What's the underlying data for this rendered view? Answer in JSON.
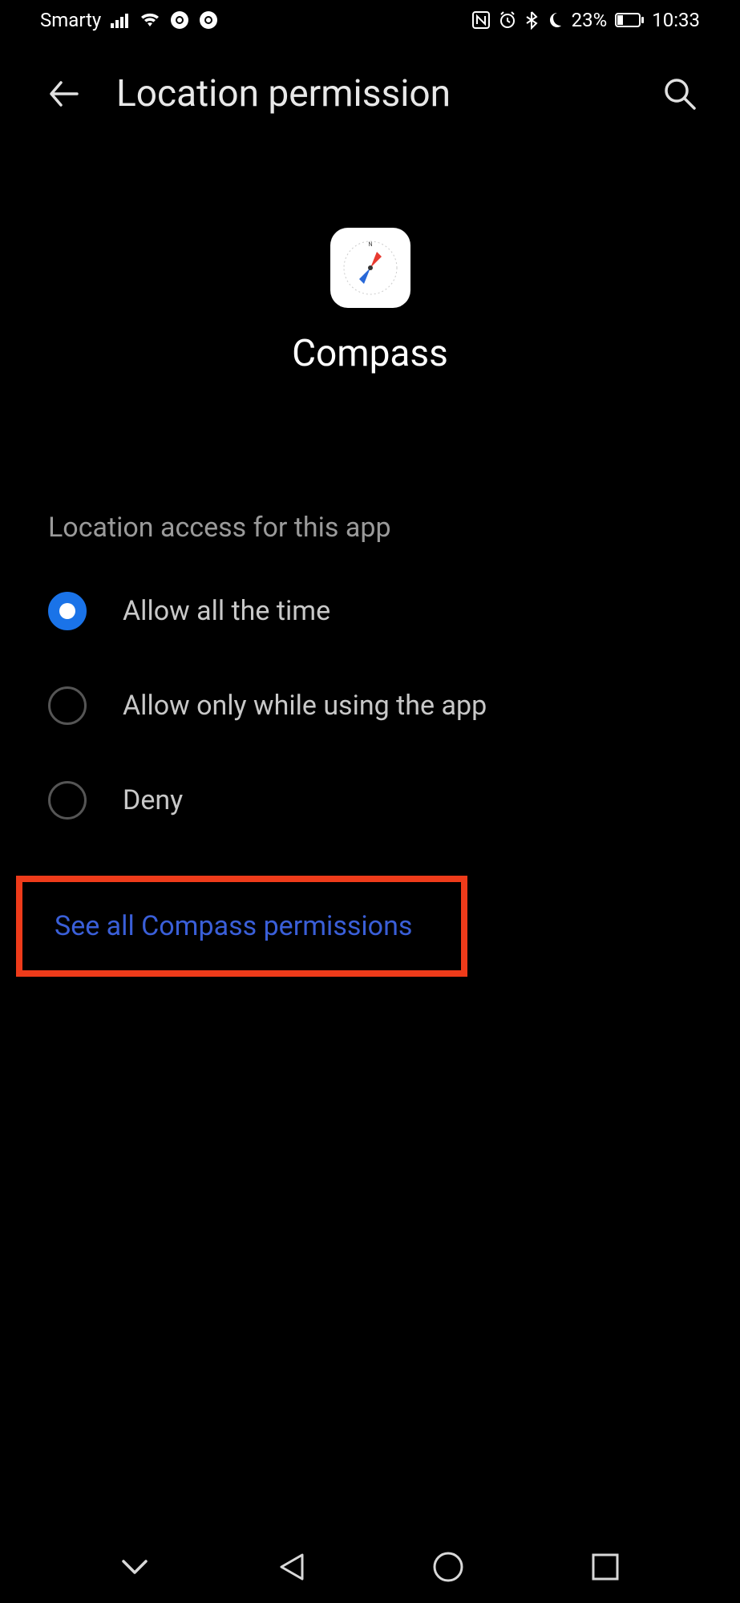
{
  "statusBar": {
    "carrier": "Smarty",
    "batteryPct": "23%",
    "time": "10:33"
  },
  "header": {
    "title": "Location permission"
  },
  "app": {
    "name": "Compass"
  },
  "section": {
    "label": "Location access for this app"
  },
  "options": [
    {
      "label": "Allow all the time",
      "selected": true
    },
    {
      "label": "Allow only while using the app",
      "selected": false
    },
    {
      "label": "Deny",
      "selected": false
    }
  ],
  "link": {
    "label": "See all Compass permissions"
  }
}
